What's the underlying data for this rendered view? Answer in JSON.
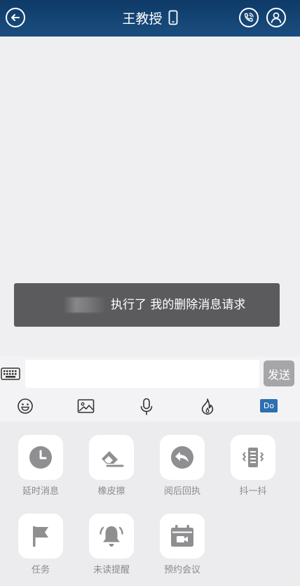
{
  "header": {
    "title": "王教授"
  },
  "toast": {
    "text": "执行了 我的删除消息请求"
  },
  "input": {
    "value": "",
    "send_label": "发送"
  },
  "toolbar": {
    "icons": [
      "emoji-icon",
      "image-icon",
      "microphone-icon",
      "burn-after-reading-icon",
      "do-icon"
    ],
    "do_label": "Do"
  },
  "panel": {
    "items": [
      {
        "label": "延时消息",
        "icon": "clock-icon"
      },
      {
        "label": "橡皮擦",
        "icon": "eraser-icon"
      },
      {
        "label": "阅后回执",
        "icon": "reply-icon"
      },
      {
        "label": "抖一抖",
        "icon": "vibrate-icon"
      },
      {
        "label": "任务",
        "icon": "flag-icon"
      },
      {
        "label": "未读提醒",
        "icon": "bell-icon"
      },
      {
        "label": "预约会议",
        "icon": "meeting-icon"
      }
    ]
  },
  "colors": {
    "header": "#0e3a67",
    "toast": "#5b5b5d",
    "send_button": "#a6a6a8",
    "icon_gray": "#8f8f91",
    "do_badge": "#2d6fb0"
  }
}
